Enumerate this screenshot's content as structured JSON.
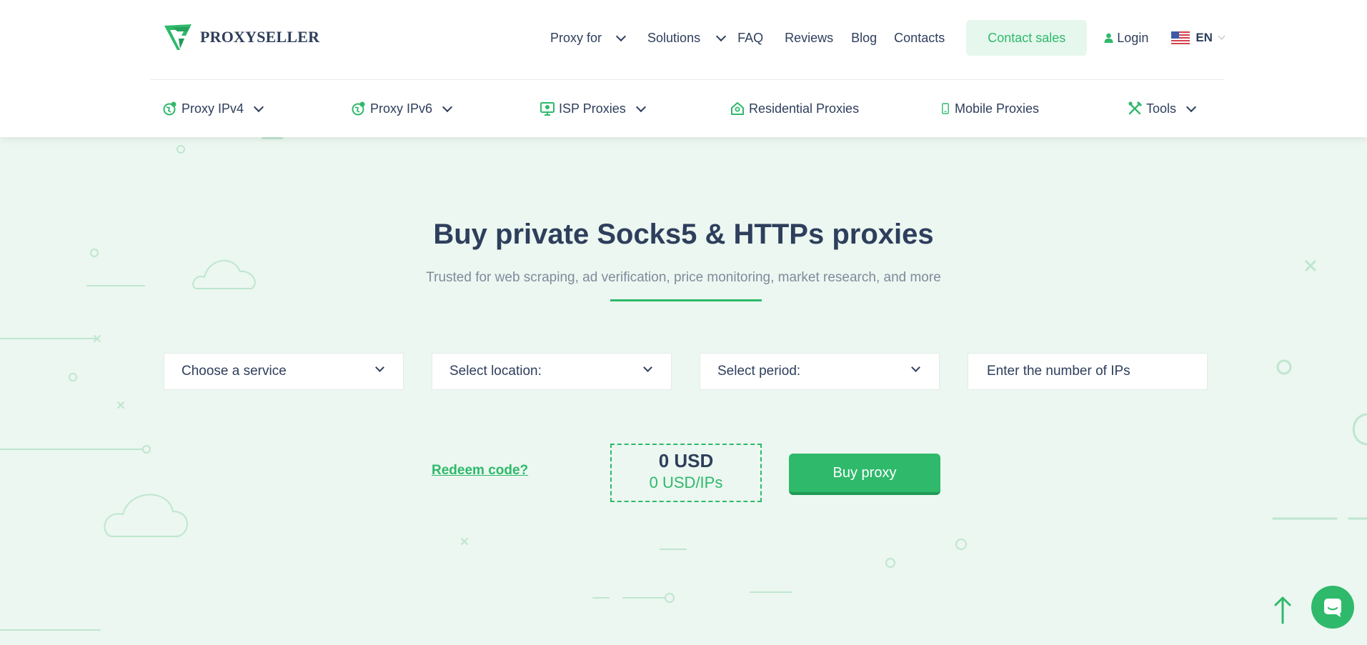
{
  "brand": {
    "name": "PROXYSELLER"
  },
  "topnav": {
    "proxy_for": "Proxy for",
    "solutions": "Solutions",
    "faq": "FAQ",
    "reviews": "Reviews",
    "blog": "Blog",
    "contacts": "Contacts",
    "contact_sales": "Contact sales",
    "login": "Login",
    "language": "EN"
  },
  "subnav": {
    "items": [
      {
        "label": "Proxy IPv4",
        "icon": "globe-icon"
      },
      {
        "label": "Proxy IPv6",
        "icon": "globe-icon"
      },
      {
        "label": "ISP Proxies",
        "icon": "monitor-icon"
      },
      {
        "label": "Residential Proxies",
        "icon": "home-icon"
      },
      {
        "label": "Mobile Proxies",
        "icon": "phone-icon"
      },
      {
        "label": "Tools",
        "icon": "tools-icon"
      }
    ]
  },
  "hero": {
    "title": "Buy private Socks5 & HTTPs proxies",
    "subtitle": "Trusted for web scraping, ad verification, price monitoring, market research, and more"
  },
  "order_form": {
    "service_label": "Choose a service",
    "location_label": "Select location:",
    "period_label": "Select period:",
    "ip_count_placeholder": "Enter the number of IPs",
    "redeem_label": "Redeem code?",
    "total_price": "0 USD",
    "price_per_ip": "0 USD/IPs",
    "buy_label": "Buy proxy"
  },
  "colors": {
    "accent": "#2fb96b",
    "text": "#2e3e5c",
    "hero_bg": "#ebf7f0"
  }
}
